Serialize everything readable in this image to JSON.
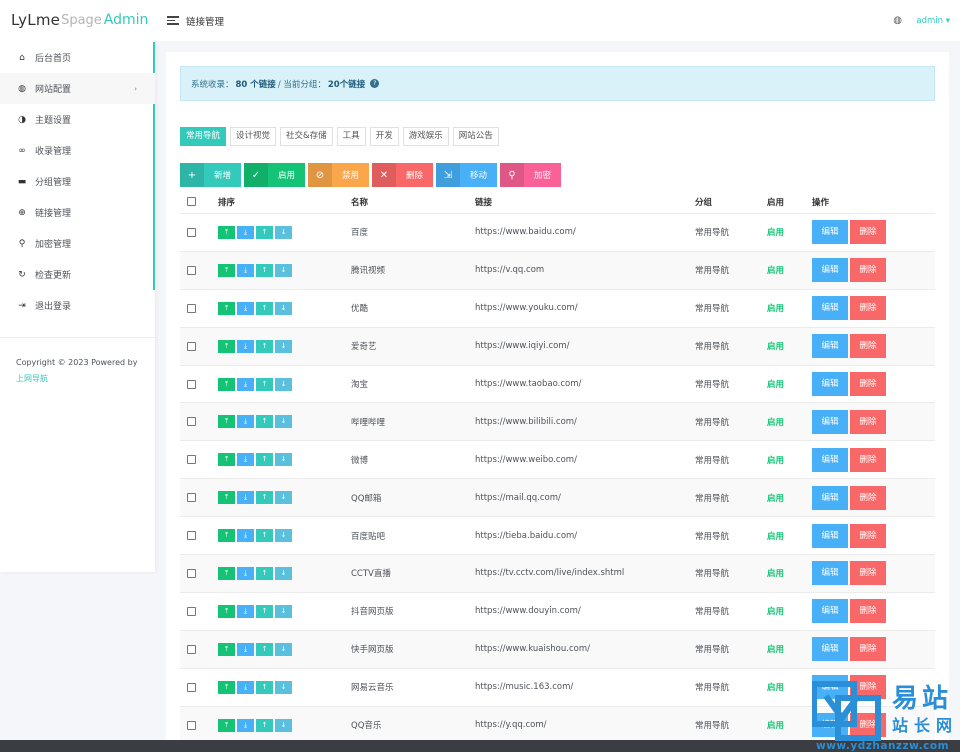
{
  "logo": {
    "part1": "LyLme",
    "part2": "Spage",
    "part3": "Admin"
  },
  "header": {
    "title": "链接管理",
    "user": "admin",
    "palette_icon": "palette-icon",
    "menu_icon": "hamburger-icon"
  },
  "sidebar": {
    "items": [
      {
        "label": "后台首页",
        "icon": "home-icon",
        "glyph": "⌂"
      },
      {
        "label": "网站配置",
        "icon": "palette-icon",
        "glyph": "◍",
        "arrow": "›"
      },
      {
        "label": "主题设置",
        "icon": "contrast-icon",
        "glyph": "◑"
      },
      {
        "label": "收录管理",
        "icon": "link-icon",
        "glyph": "∞"
      },
      {
        "label": "分组管理",
        "icon": "folder-icon",
        "glyph": "▬"
      },
      {
        "label": "链接管理",
        "icon": "globe-icon",
        "glyph": "⊕"
      },
      {
        "label": "加密管理",
        "icon": "key-icon",
        "glyph": "⚲"
      },
      {
        "label": "检查更新",
        "icon": "refresh-icon",
        "glyph": "↻"
      },
      {
        "label": "退出登录",
        "icon": "logout-icon",
        "glyph": "⇥"
      }
    ],
    "copyright_prefix": "Copyright © 2023 Powered by",
    "copyright_link": "上网导航"
  },
  "alert": {
    "prefix": "系统收录：",
    "total": "80 个链接",
    "sep": " / 当前分组：",
    "current": "20个链接",
    "help": "?"
  },
  "tabs": [
    "常用导航",
    "设计视觉",
    "社交&存储",
    "工具",
    "开发",
    "游戏娱乐",
    "网站公告"
  ],
  "actions": [
    {
      "label": "新增",
      "icon": "plus-icon",
      "glyph": "+",
      "color": "#33cabb"
    },
    {
      "label": "启用",
      "icon": "check-icon",
      "glyph": "✓",
      "color": "#15c377"
    },
    {
      "label": "禁用",
      "icon": "ban-icon",
      "glyph": "⊘",
      "color": "#faa64b"
    },
    {
      "label": "删除",
      "icon": "close-icon",
      "glyph": "✕",
      "color": "#f96868"
    },
    {
      "label": "移动",
      "icon": "move-icon",
      "glyph": "⇲",
      "color": "#48b0f7"
    },
    {
      "label": "加密",
      "icon": "key-icon",
      "glyph": "⚲",
      "color": "#f96197"
    }
  ],
  "table": {
    "headers": {
      "sort": "排序",
      "name": "名称",
      "url": "链接",
      "group": "分组",
      "enabled": "启用",
      "ops": "操作"
    },
    "sort_glyphs": [
      "⤒",
      "⤓",
      "↑",
      "↓"
    ],
    "edit_label": "编辑",
    "delete_label": "删除",
    "rows": [
      {
        "name": "百度",
        "url": "https://www.baidu.com/",
        "group": "常用导航",
        "status": "启用"
      },
      {
        "name": "腾讯视频",
        "url": "https://v.qq.com",
        "group": "常用导航",
        "status": "启用"
      },
      {
        "name": "优酷",
        "url": "https://www.youku.com/",
        "group": "常用导航",
        "status": "启用"
      },
      {
        "name": "爱奇艺",
        "url": "https://www.iqiyi.com/",
        "group": "常用导航",
        "status": "启用"
      },
      {
        "name": "淘宝",
        "url": "https://www.taobao.com/",
        "group": "常用导航",
        "status": "启用"
      },
      {
        "name": "哔哩哔哩",
        "url": "https://www.bilibili.com/",
        "group": "常用导航",
        "status": "启用"
      },
      {
        "name": "微博",
        "url": "https://www.weibo.com/",
        "group": "常用导航",
        "status": "启用"
      },
      {
        "name": "QQ邮箱",
        "url": "https://mail.qq.com/",
        "group": "常用导航",
        "status": "启用"
      },
      {
        "name": "百度贴吧",
        "url": "https://tieba.baidu.com/",
        "group": "常用导航",
        "status": "启用"
      },
      {
        "name": "CCTV直播",
        "url": "https://tv.cctv.com/live/index.shtml",
        "group": "常用导航",
        "status": "启用"
      },
      {
        "name": "抖音网页版",
        "url": "https://www.douyin.com/",
        "group": "常用导航",
        "status": "启用"
      },
      {
        "name": "快手网页版",
        "url": "https://www.kuaishou.com/",
        "group": "常用导航",
        "status": "启用"
      },
      {
        "name": "网易云音乐",
        "url": "https://music.163.com/",
        "group": "常用导航",
        "status": "启用"
      },
      {
        "name": "QQ音乐",
        "url": "https://y.qq.com/",
        "group": "常用导航",
        "status": "启用"
      }
    ]
  },
  "watermark": {
    "t1": "易站",
    "t2": "站长网",
    "t3": "www.ydzhanzzw.com"
  }
}
